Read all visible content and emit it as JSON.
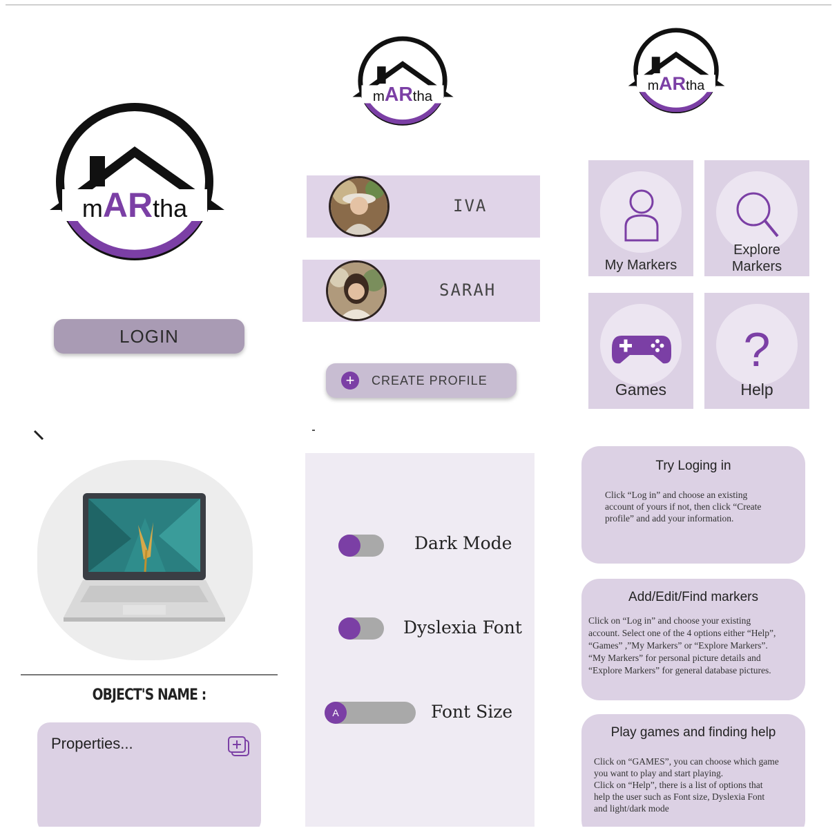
{
  "brand": {
    "logo_text_left": "m",
    "logo_text_mid": "AR",
    "logo_text_right": "tha",
    "accent": "#7b3fa5",
    "tile_bg": "#dcd1e4"
  },
  "login_screen": {
    "login_label": "LOGIN"
  },
  "profile_screen": {
    "profiles": [
      {
        "name": "IVA"
      },
      {
        "name": "SARAH"
      }
    ],
    "create_label": "CREATE PROFILE"
  },
  "menu_screen": {
    "tiles": [
      {
        "label_line1": "My Markers",
        "label_line2": "",
        "icon": "person-icon"
      },
      {
        "label_line1": "Explore",
        "label_line2": "Markers",
        "icon": "magnifier-icon"
      },
      {
        "label_line1": "Games",
        "label_line2": "",
        "icon": "gamepad-icon"
      },
      {
        "label_line1": "Help",
        "label_line2": "",
        "icon": "question-mark-icon"
      }
    ]
  },
  "object_screen": {
    "object_name_label": "OBJECT'S NAME :",
    "properties_label": "Properties..."
  },
  "settings_screen": {
    "dark_mode": "Dark Mode",
    "dyslexia_font": "Dyslexia Font",
    "font_size": "Font Size",
    "font_size_knob": "A"
  },
  "help_screen": {
    "cards": [
      {
        "title": "Try Loging in",
        "body": [
          "Click “Log in” and choose an existing",
          "account of yours if not, then click “Create",
          "profile” and add your information."
        ]
      },
      {
        "title": "Add/Edit/Find markers",
        "body": [
          "Click on “Log in” and choose your existing",
          "account. Select one of the 4 options either “Help”,",
          "“Games” ,”My Markers” or “Explore Markers”.",
          "“My Markers” for personal picture details and",
          "“Explore Markers” for general database pictures."
        ]
      },
      {
        "title": "Play games and finding help",
        "body": [
          "Click on “GAMES”, you can choose which game",
          "you want to play and start playing.",
          "Click on “Help”, there is a list of options that",
          "help the user such as Font size, Dyslexia Font",
          "and light/dark mode"
        ]
      }
    ]
  }
}
